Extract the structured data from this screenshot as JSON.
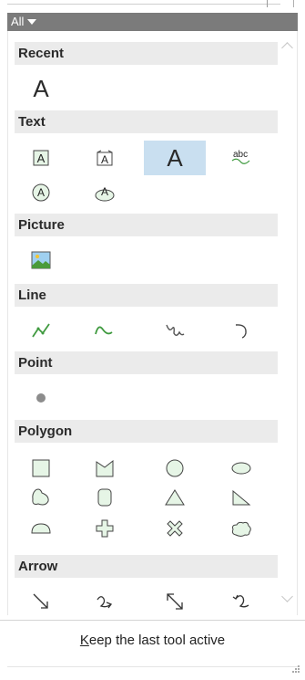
{
  "dropdown": {
    "label": "All"
  },
  "sections": {
    "recent": "Recent",
    "text": "Text",
    "picture": "Picture",
    "line": "Line",
    "point": "Point",
    "polygon": "Polygon",
    "arrow": "Arrow"
  },
  "recent_tool_glyph": "A",
  "text_tool_glyphs": {
    "large_a": "A",
    "abc": "abc"
  },
  "footer": {
    "accesskey": "K",
    "rest": "eep the last tool active"
  },
  "colors": {
    "accent_green": "#3f9a3f",
    "selected_bg": "#c9dff0",
    "header_bg": "#ebebeb",
    "dropdown_bg": "#7b7b7b",
    "shape_fill": "#e6f5e6",
    "shape_stroke": "#4a4a4a",
    "point_fill": "#8c8c8c"
  },
  "icons": [
    "recent-text-icon",
    "text-box-icon",
    "text-box-fitted-icon",
    "text-large-icon",
    "text-curved-icon",
    "text-circle-icon",
    "text-callout-icon",
    "picture-icon",
    "polyline-icon",
    "curve-icon",
    "freehand-icon",
    "arc-icon",
    "point-icon",
    "rectangle-icon",
    "polygon-icon",
    "circle-icon",
    "ellipse-icon",
    "freehand-polygon-icon",
    "rounded-rectangle-icon",
    "triangle-icon",
    "right-triangle-icon",
    "half-circle-icon",
    "cross-icon",
    "x-shape-icon",
    "cloud-icon",
    "arrow-straight-icon",
    "arrow-curved-icon",
    "arrow-double-icon",
    "arrow-curved-back-icon"
  ]
}
